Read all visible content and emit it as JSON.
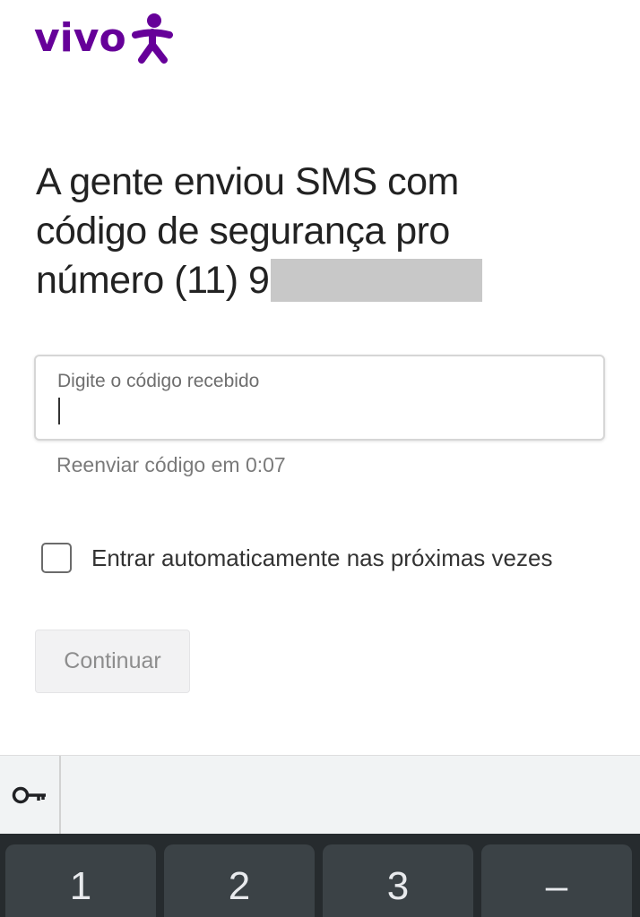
{
  "brand": {
    "logo_text": "vivo",
    "color": "#660099"
  },
  "headline": {
    "line1": "A gente enviou SMS com",
    "line2": "código de segurança pro",
    "line3": "número (11) 9"
  },
  "code_input": {
    "placeholder": "Digite o código recebido",
    "value": ""
  },
  "resend": {
    "text": "Reenviar código em 0:07"
  },
  "auto_login": {
    "label": "Entrar automaticamente nas próximas vezes",
    "checked": false
  },
  "continue_button": {
    "label": "Continuar",
    "enabled": false
  },
  "keyboard": {
    "suggestion_icon": "key-icon",
    "keys": [
      "1",
      "2",
      "3",
      "–"
    ]
  }
}
